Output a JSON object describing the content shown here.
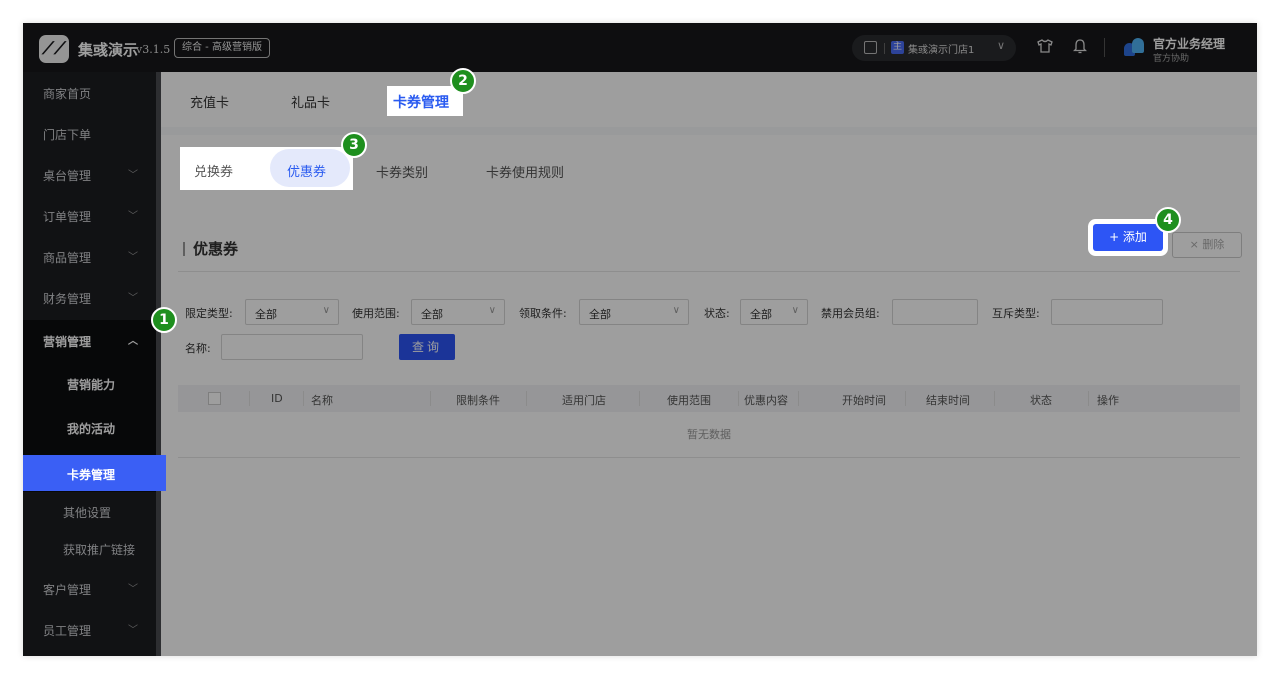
{
  "header": {
    "app_name": "集彧演示",
    "version": "v3.1.5",
    "edition": "综合 - 高级营销版",
    "store_badge": "主",
    "store_name": "集彧演示门店1",
    "user_name": "官方业务经理",
    "user_role": "官方协助"
  },
  "sidebar": {
    "items": [
      {
        "label": "商家首页"
      },
      {
        "label": "门店下单"
      },
      {
        "label": "桌台管理"
      },
      {
        "label": "订单管理"
      },
      {
        "label": "商品管理"
      },
      {
        "label": "财务管理"
      },
      {
        "label": "营销管理"
      },
      {
        "label": "客户管理"
      },
      {
        "label": "员工管理"
      }
    ],
    "sub_items": [
      {
        "label": "营销能力"
      },
      {
        "label": "我的活动"
      },
      {
        "label": "卡券管理"
      },
      {
        "label": "其他设置"
      },
      {
        "label": "获取推广链接"
      }
    ]
  },
  "tabs": [
    {
      "label": "充值卡"
    },
    {
      "label": "礼品卡"
    },
    {
      "label": "卡券管理"
    }
  ],
  "subtabs": [
    {
      "label": "兑换券"
    },
    {
      "label": "优惠券"
    },
    {
      "label": "卡券类别"
    },
    {
      "label": "卡券使用规则"
    }
  ],
  "section_title": "优惠券",
  "buttons": {
    "add": "+ 添加",
    "delete": "× 删除",
    "query": "查询"
  },
  "filters": {
    "limit_type": {
      "label": "限定类型:",
      "value": "全部"
    },
    "scope": {
      "label": "使用范围:",
      "value": "全部"
    },
    "condition": {
      "label": "领取条件:",
      "value": "全部"
    },
    "status": {
      "label": "状态:",
      "value": "全部"
    },
    "banned_group": {
      "label": "禁用会员组:"
    },
    "exclusive_type": {
      "label": "互斥类型:"
    },
    "name": {
      "label": "名称:"
    }
  },
  "table": {
    "columns": [
      "ID",
      "名称",
      "限制条件",
      "适用门店",
      "使用范围",
      "优惠内容",
      "开始时间",
      "结束时间",
      "状态",
      "操作"
    ],
    "empty_text": "暂无数据"
  },
  "markers": [
    "1",
    "2",
    "3",
    "4"
  ]
}
